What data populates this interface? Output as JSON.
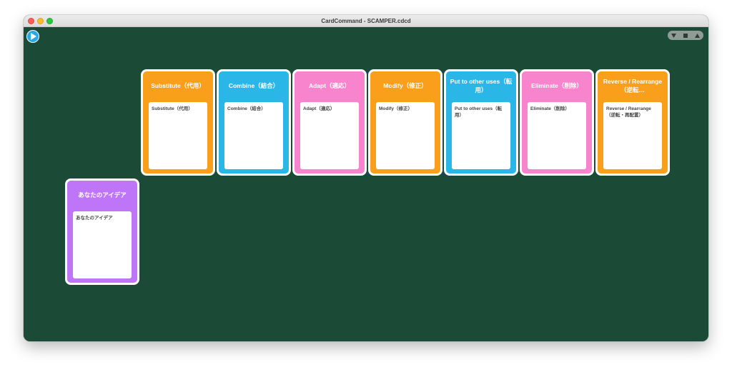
{
  "window": {
    "title": "CardCommand - SCAMPER.cdcd"
  },
  "toolbar": {
    "play_icon": "play-icon",
    "zoom_controls": [
      "triangle-down-icon",
      "square-icon",
      "triangle-up-icon"
    ]
  },
  "colors": {
    "canvas": "#1b4a36",
    "orange": "#f99f1b",
    "blue": "#2ab7e8",
    "pink": "#f784cc",
    "purple": "#bf75f7"
  },
  "cards": [
    {
      "title": "Substitute（代用）",
      "body": "Substitute（代用）",
      "color": "orange"
    },
    {
      "title": "Combine（結合）",
      "body": "Combine（結合）",
      "color": "blue"
    },
    {
      "title": "Adapt（適応）",
      "body": "Adapt（適応）",
      "color": "pink"
    },
    {
      "title": "Modify（修正）",
      "body": "Modify（修正）",
      "color": "orange"
    },
    {
      "title": "Put to other uses（転用）",
      "body": "Put to other uses（転用）",
      "color": "blue"
    },
    {
      "title": "Eliminate（削除）",
      "body": "Eliminate（削除）",
      "color": "pink"
    },
    {
      "title": "Reverse / Rearrange（逆転…",
      "body": "Reverse / Rearrange（逆転・再配置）",
      "color": "orange"
    },
    {
      "title": "あなたのアイデア",
      "body": "あなたのアイデア",
      "color": "purple"
    }
  ]
}
